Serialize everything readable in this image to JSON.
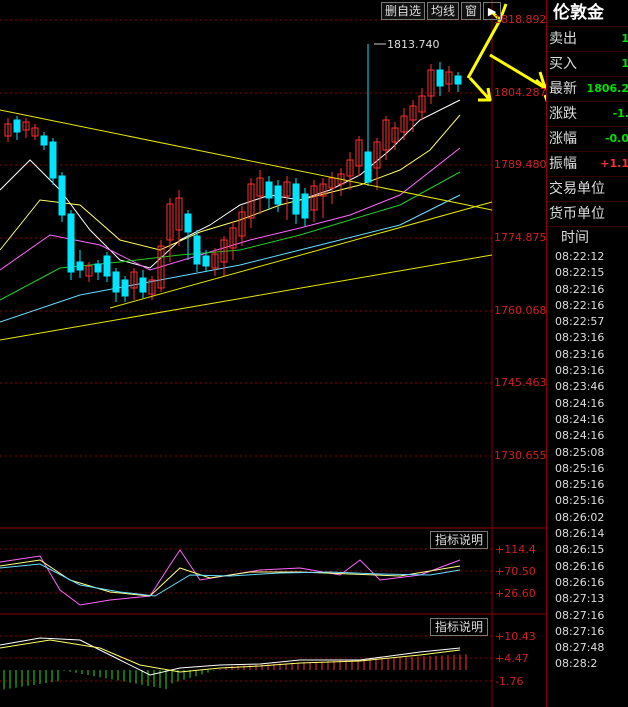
{
  "toolbar": {
    "watchlist_label": "删自选",
    "ma_label": "均线",
    "window_label": "窗",
    "sound_icon": "speaker-icon"
  },
  "price_axis": [
    "1818.892",
    "1804.287",
    "1789.480",
    "1774.875",
    "1760.068",
    "1745.463",
    "1730.655"
  ],
  "high_annotation": "1813.740",
  "indicator1": {
    "button": "指标说明",
    "levels": [
      "+114.4",
      "+70.50",
      "+26.60"
    ]
  },
  "indicator2": {
    "button": "指标说明",
    "levels": [
      "+10.43",
      "+4.47",
      "-1.76"
    ]
  },
  "quote": {
    "title": "伦敦金",
    "rows": [
      {
        "label": "卖出",
        "value": "1"
      },
      {
        "label": "买入",
        "value": "1"
      },
      {
        "label": "最新",
        "value": "1806.2"
      },
      {
        "label": "涨跌",
        "value": "-1."
      },
      {
        "label": "涨幅",
        "value": "-0.0"
      },
      {
        "label": "振幅",
        "value": "+1.1"
      },
      {
        "label": "交易单位",
        "value": ""
      },
      {
        "label": "货币单位",
        "value": ""
      }
    ],
    "time_header": "时间",
    "times": [
      "08:22:12",
      "08:22:15",
      "08:22:16",
      "08:22:16",
      "08:22:57",
      "08:23:16",
      "08:23:16",
      "08:23:16",
      "08:23:46",
      "08:24:16",
      "08:24:16",
      "08:24:16",
      "08:25:08",
      "08:25:16",
      "08:25:16",
      "08:25:16",
      "08:26:02",
      "08:26:14",
      "08:26:15",
      "08:26:16",
      "08:26:16",
      "08:27:13",
      "08:27:16",
      "08:27:16",
      "08:27:48",
      "08:28:2"
    ]
  },
  "colors": {
    "up": "#ff3030",
    "down": "#00e5ff",
    "grid": "#8b0000",
    "trend": "#e8e800",
    "annotation_arrow": "#ffff00"
  }
}
